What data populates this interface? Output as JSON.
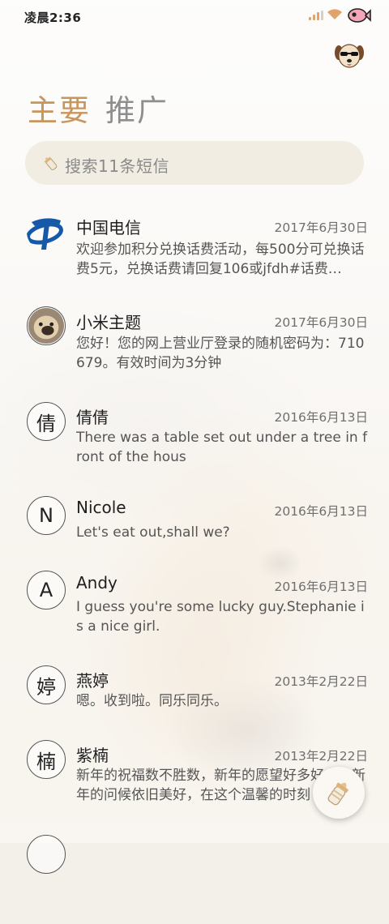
{
  "status_bar": {
    "time": "凌晨2:36",
    "accent": "#e0a36b"
  },
  "tabs": {
    "main": "主要",
    "promo": "推广",
    "active_color": "#c8955d"
  },
  "search": {
    "placeholder": "搜索11条短信",
    "icon": "feeding-bottle-icon"
  },
  "messages": [
    {
      "name": "中国电信",
      "date": "2017年6月30日",
      "preview": "欢迎参加积分兑换话费活动，每500分可兑换话费5元，兑换话费请回复106或jfdh#话费…",
      "avatar": "china-telecom-logo"
    },
    {
      "name": "小米主题",
      "date": "2017年6月30日",
      "preview": "您好！您的网上营业厅登录的随机密码为：710679。有效时间为3分钟",
      "avatar": "pug-photo"
    },
    {
      "name": "倩倩",
      "date": "2016年6月13日",
      "preview": "There was a table set out under a tree in front of the hous",
      "avatar_char": "倩"
    },
    {
      "name": "Nicole",
      "date": "2016年6月13日",
      "preview": "Let's eat out,shall we?",
      "avatar_char": "N"
    },
    {
      "name": "Andy",
      "date": "2016年6月13日",
      "preview": "I guess you're some lucky guy.Stephanie is a nice girl.",
      "avatar_char": "A"
    },
    {
      "name": "燕婷",
      "date": "2013年2月22日",
      "preview": "嗯。收到啦。同乐同乐。",
      "avatar_char": "婷"
    },
    {
      "name": "紫楠",
      "date": "2013年2月22日",
      "preview": "新年的祝福数不胜数，新年的愿望好多好多，新年的问候依旧美好，在这个温馨的时刻",
      "avatar_char": "楠"
    }
  ],
  "fab": {
    "icon": "feeding-bottle-icon"
  }
}
